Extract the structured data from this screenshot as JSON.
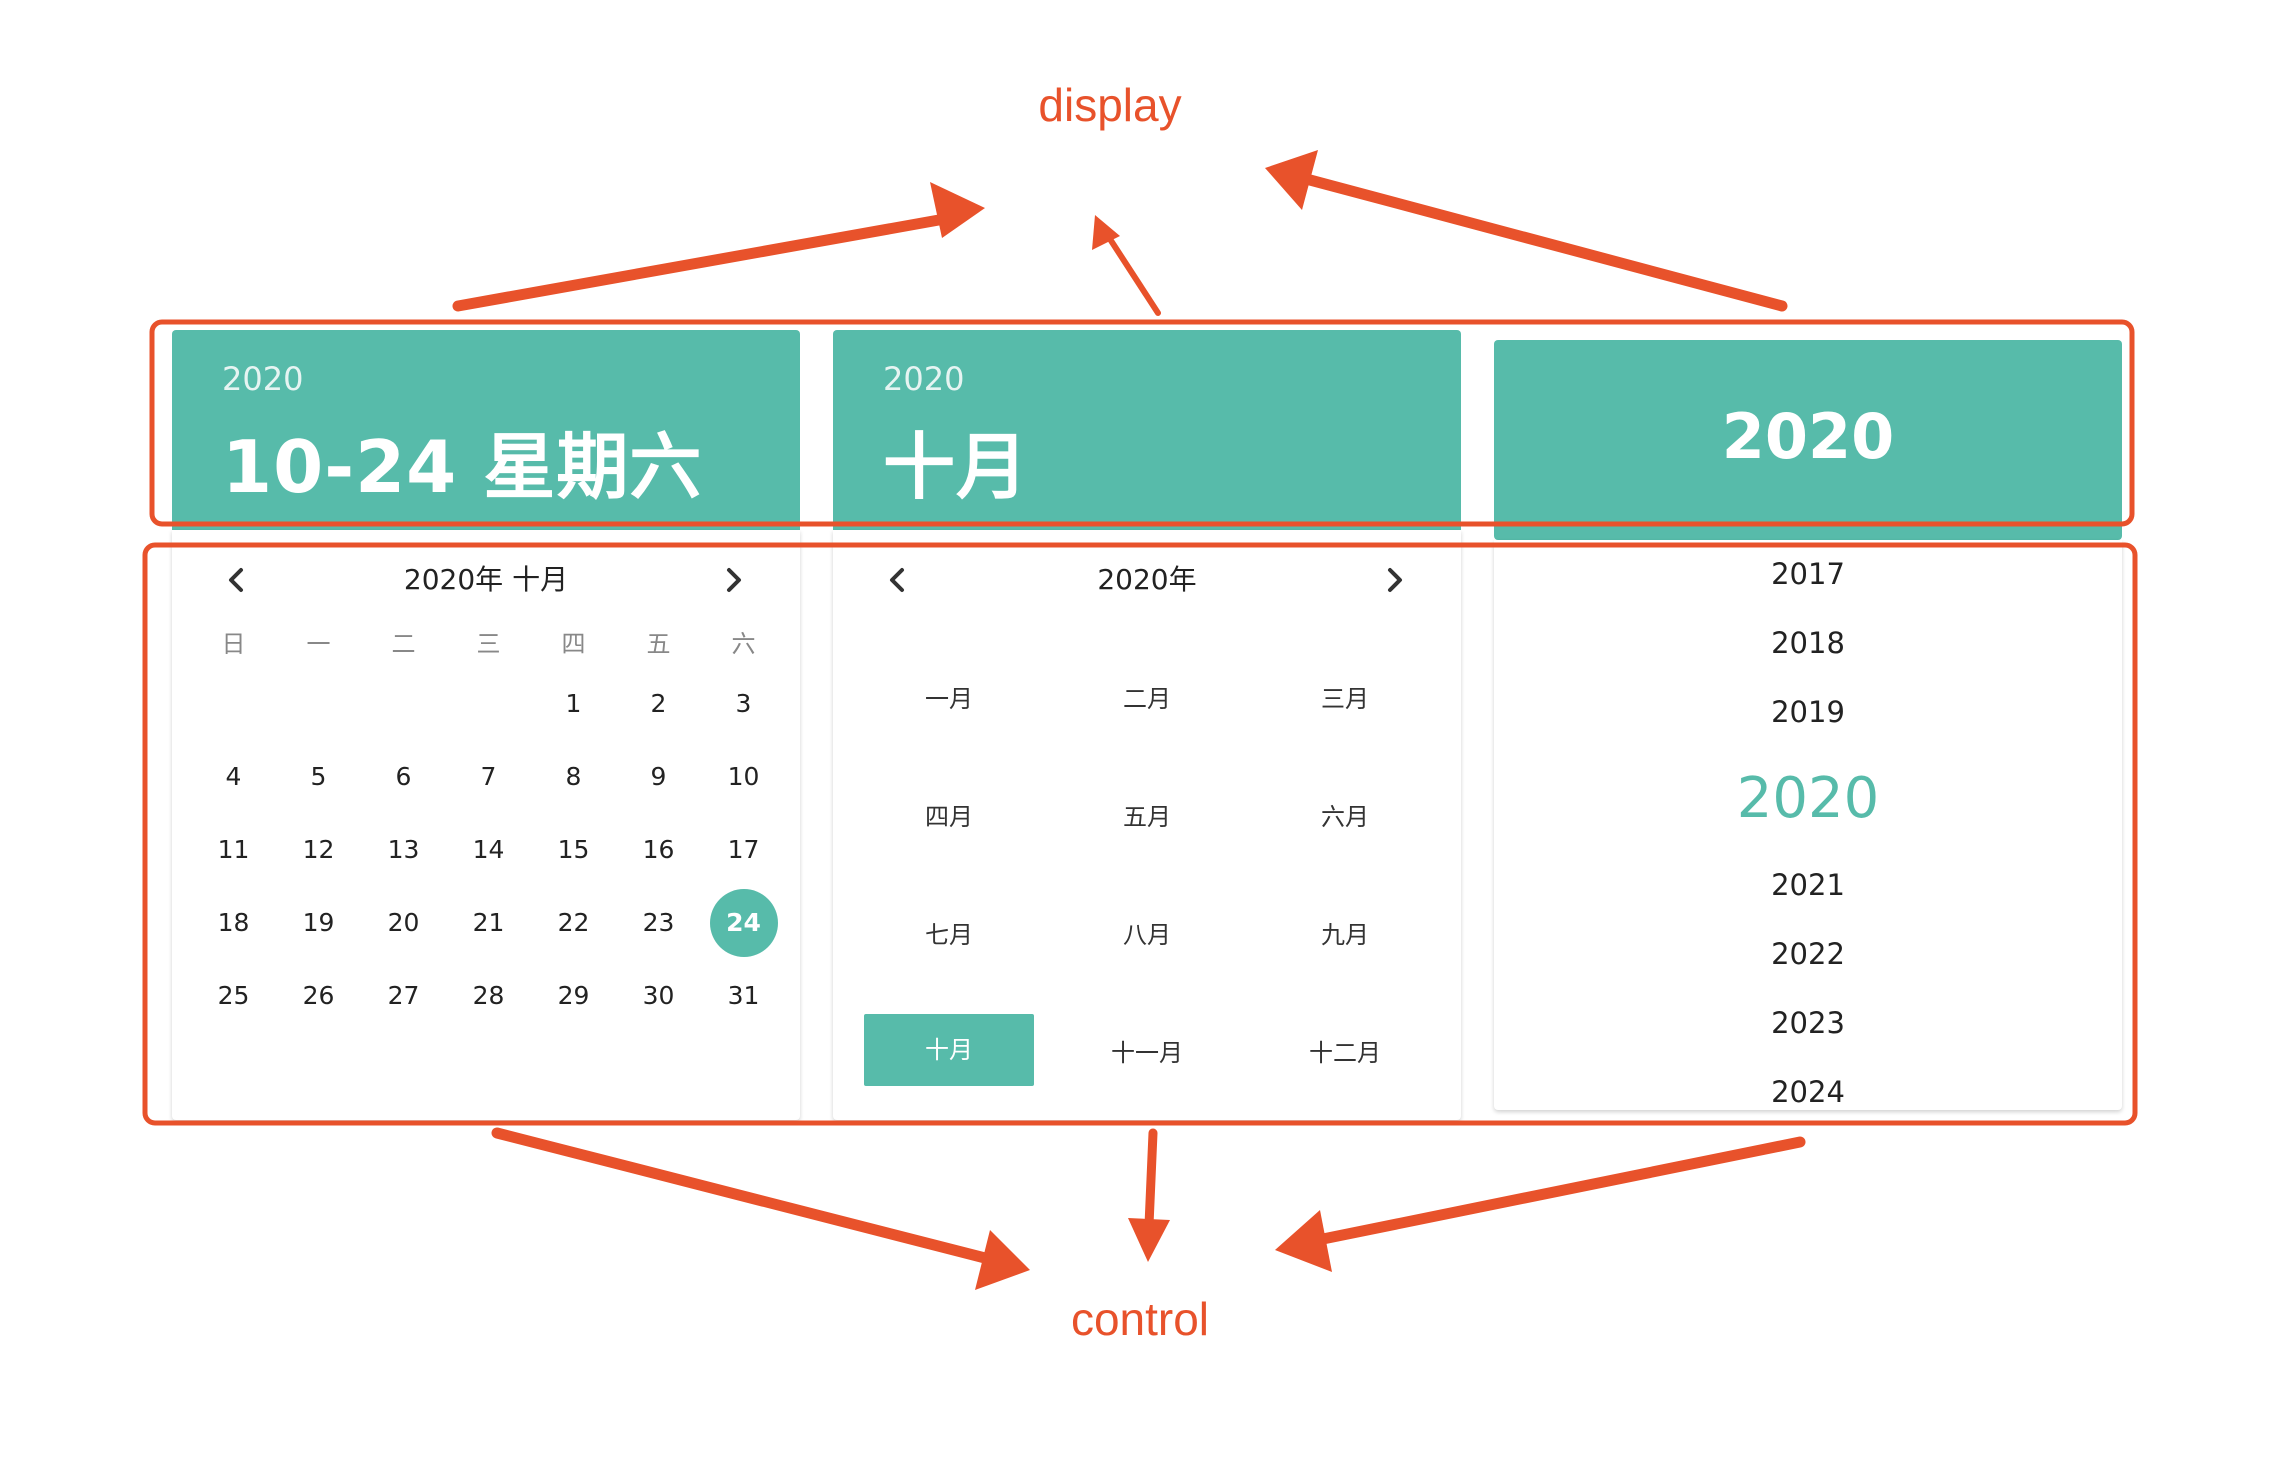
{
  "annotations": {
    "display_label": "display",
    "control_label": "control",
    "accent_color": "#e8522b"
  },
  "theme": {
    "primary": "#57bbaa"
  },
  "date_picker": {
    "header_year": "2020",
    "header_date": "10-24 星期六",
    "prev_icon": "chevron-left-icon",
    "next_icon": "chevron-right-icon",
    "nav_title": "2020年 十月",
    "weekdays": [
      "日",
      "一",
      "二",
      "三",
      "四",
      "五",
      "六"
    ],
    "weeks": [
      [
        "",
        "",
        "",
        "",
        "1",
        "2",
        "3"
      ],
      [
        "4",
        "5",
        "6",
        "7",
        "8",
        "9",
        "10"
      ],
      [
        "11",
        "12",
        "13",
        "14",
        "15",
        "16",
        "17"
      ],
      [
        "18",
        "19",
        "20",
        "21",
        "22",
        "23",
        "24"
      ],
      [
        "25",
        "26",
        "27",
        "28",
        "29",
        "30",
        "31"
      ]
    ],
    "selected_day": "24"
  },
  "month_picker": {
    "header_year": "2020",
    "header_month": "十月",
    "nav_title": "2020年",
    "months": [
      "一月",
      "二月",
      "三月",
      "四月",
      "五月",
      "六月",
      "七月",
      "八月",
      "九月",
      "十月",
      "十一月",
      "十二月"
    ],
    "selected_month": "十月"
  },
  "year_picker": {
    "header_year": "2020",
    "years": [
      "2017",
      "2018",
      "2019",
      "2020",
      "2021",
      "2022",
      "2023",
      "2024"
    ],
    "selected_year": "2020"
  }
}
